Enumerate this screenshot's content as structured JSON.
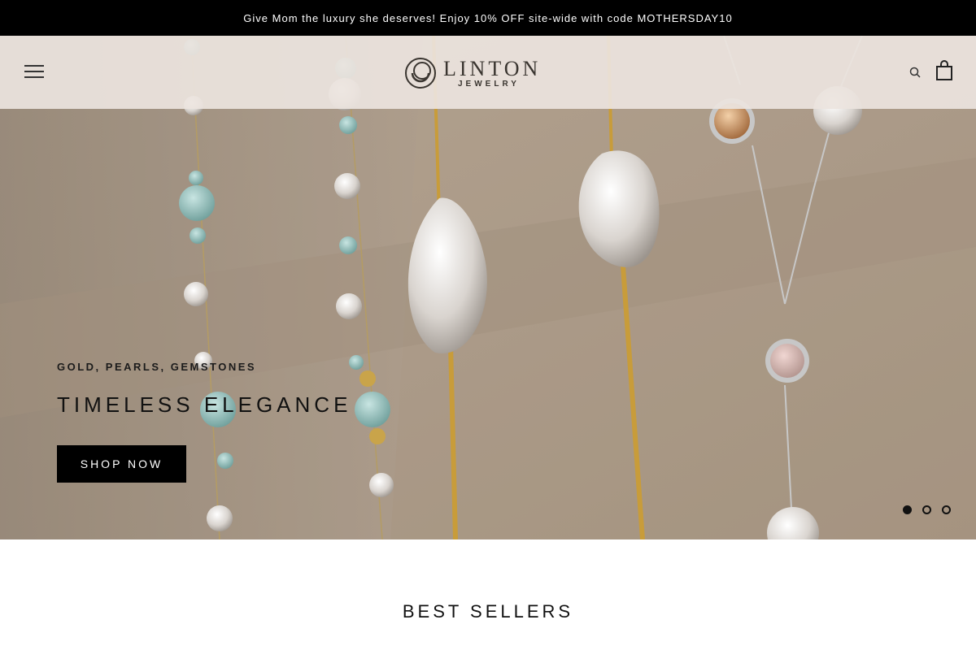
{
  "announcement": {
    "text": "Give Mom the luxury she deserves! Enjoy 10% OFF site-wide with code MOTHERSDAY10"
  },
  "header": {
    "logo_name": "LINTON",
    "logo_sub": "JEWELRY",
    "icons": [
      "hamburger-menu-icon",
      "search-icon",
      "shopping-bag-icon"
    ]
  },
  "hero": {
    "eyebrow": "GOLD, PEARLS, GEMSTONES",
    "headline": "TIMELESS ELEGANCE",
    "cta_label": "SHOP NOW",
    "slides_total": 3,
    "active_slide": 1
  },
  "best_sellers": {
    "title": "BEST SELLERS"
  },
  "colors": {
    "announcement_bg": "#000000",
    "cta_bg": "#000000",
    "hero_bg": "#c9b7a2"
  }
}
